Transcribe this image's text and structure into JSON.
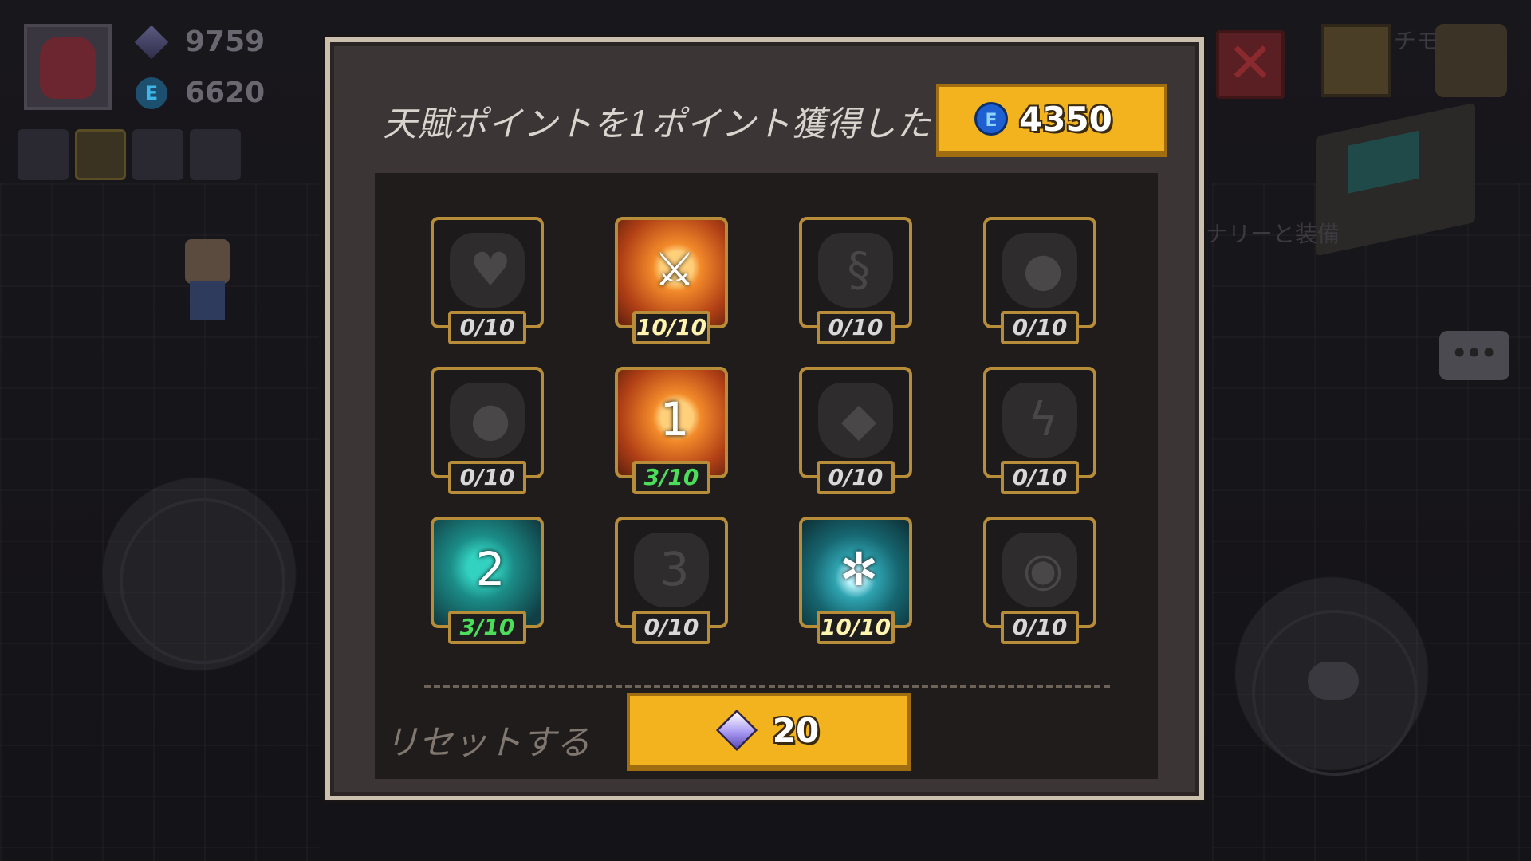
{
  "hud": {
    "gems": "9759",
    "coins": "6620",
    "coin_symbol": "E",
    "side_text_top": "チモ",
    "side_text_mid": "ナリーと装備"
  },
  "modal": {
    "title": "天賦ポイントを1ポイント獲得した",
    "coin_cost": "4350",
    "coin_symbol": "E",
    "reset_label": "リセットする",
    "reset_cost": "20"
  },
  "talents": [
    {
      "level": "0/10",
      "icon": "heart-icon",
      "glyph": "♥",
      "state": "locked"
    },
    {
      "level": "10/10",
      "icon": "sword-icon",
      "glyph": "⚔",
      "state": "maxed"
    },
    {
      "level": "0/10",
      "icon": "swirl-icon",
      "glyph": "§",
      "state": "locked"
    },
    {
      "level": "0/10",
      "icon": "drop-icon",
      "glyph": "●",
      "state": "locked"
    },
    {
      "level": "0/10",
      "icon": "bomb-icon",
      "glyph": "●",
      "state": "locked"
    },
    {
      "level": "3/10",
      "icon": "skill-one-icon",
      "glyph": "1",
      "state": "partial"
    },
    {
      "level": "0/10",
      "icon": "diamond-icon",
      "glyph": "◆",
      "state": "locked"
    },
    {
      "level": "0/10",
      "icon": "lightning-icon",
      "glyph": "ϟ",
      "state": "locked"
    },
    {
      "level": "3/10",
      "icon": "skill-two-icon",
      "glyph": "2",
      "state": "partial"
    },
    {
      "level": "0/10",
      "icon": "skill-three-icon",
      "glyph": "3",
      "state": "locked"
    },
    {
      "level": "10/10",
      "icon": "frost-icon",
      "glyph": "✲",
      "state": "maxed"
    },
    {
      "level": "0/10",
      "icon": "eye-icon",
      "glyph": "◉",
      "state": "locked"
    }
  ],
  "colors": {
    "gold_button": "#f2b31e",
    "frame_gold": "#b88d3a",
    "modal_border": "#cbbfae",
    "partial_level": "#4cde5a"
  }
}
